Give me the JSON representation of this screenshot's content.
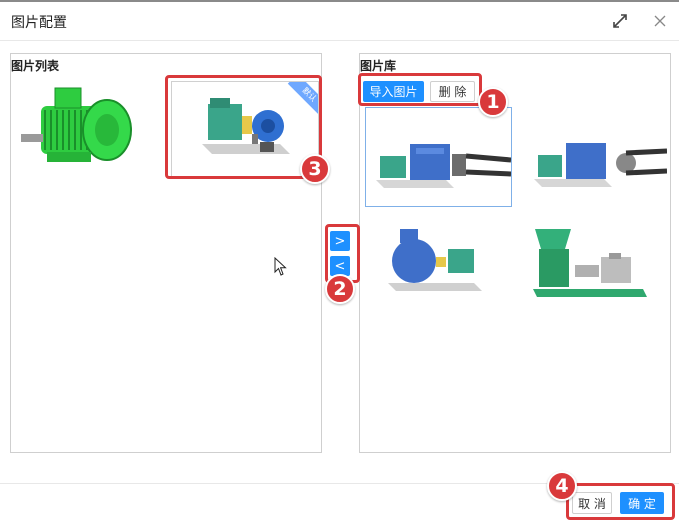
{
  "dialog": {
    "title": "图片配置"
  },
  "left_panel": {
    "label": "图片列表",
    "selected_tag": "默认"
  },
  "right_panel": {
    "label": "图片库",
    "import_label": "导入图片",
    "delete_label": "删 除"
  },
  "transfer": {
    "right_arrow": ">",
    "left_arrow": "<"
  },
  "footer": {
    "cancel_label": "取 消",
    "confirm_label": "确 定"
  },
  "annotations": [
    "1",
    "2",
    "3",
    "4"
  ],
  "icons": {
    "expand": "expand-icon",
    "close": "close-icon",
    "cursor": "mouse-cursor-icon"
  },
  "colors": {
    "accent": "#1e90ff",
    "highlight": "#d9393b"
  }
}
